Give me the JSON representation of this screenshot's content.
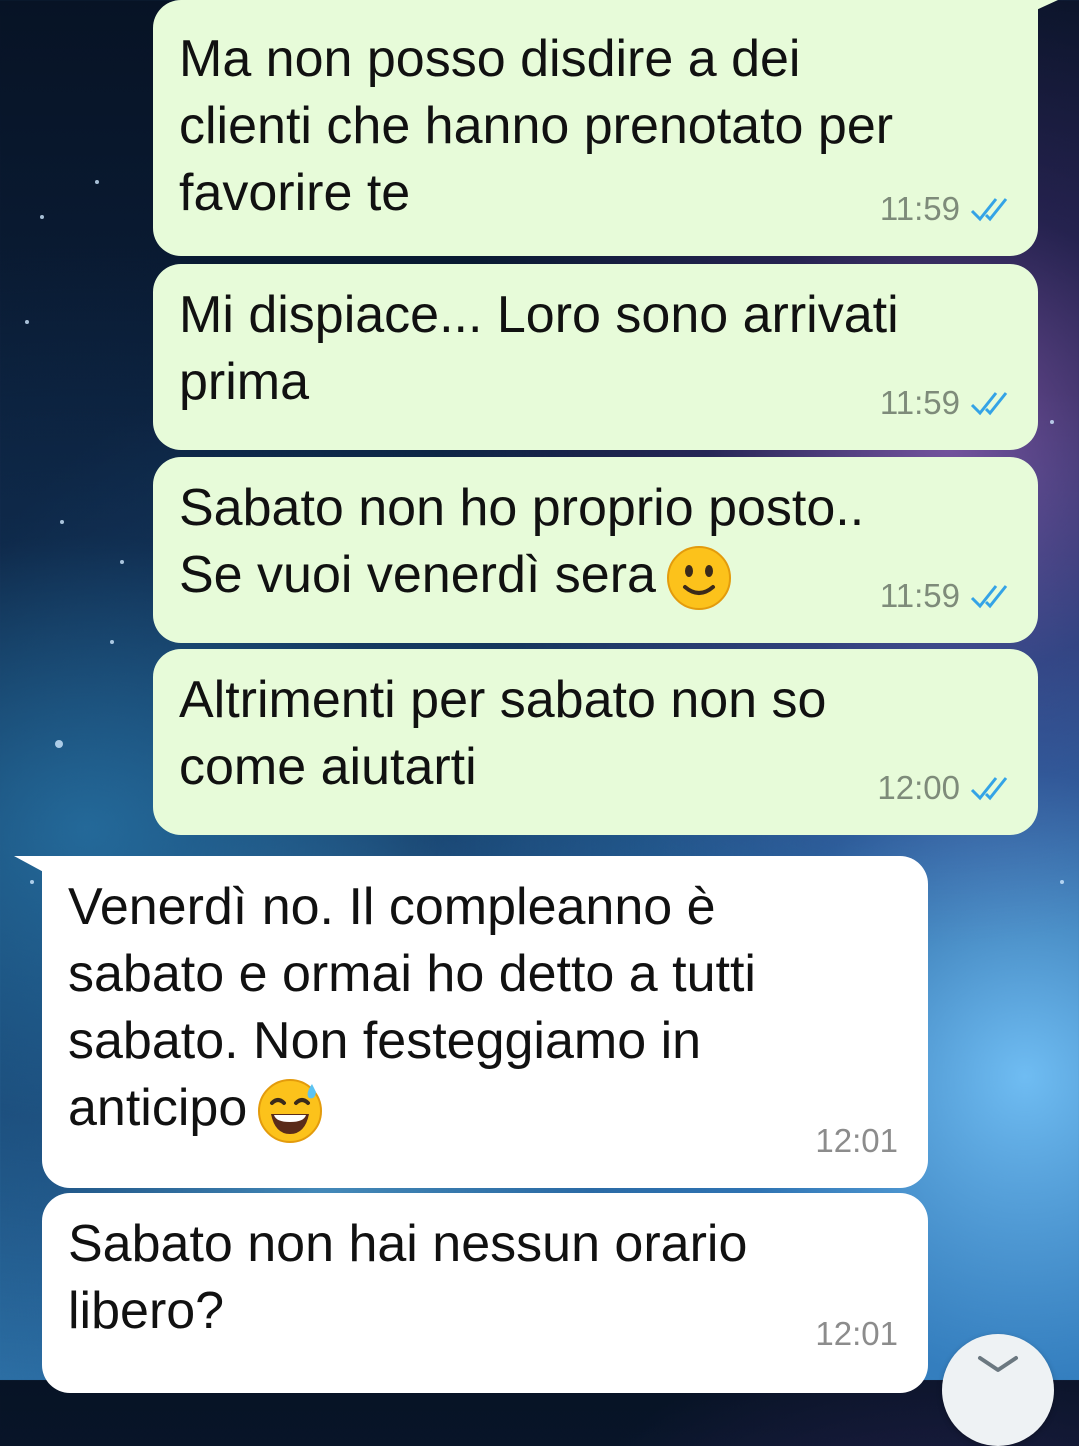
{
  "messages": [
    {
      "dir": "out",
      "text": "Ma non posso disdire a dei\nclienti che hanno prenotato per\nfavorire te",
      "time": "11:59",
      "status": "read"
    },
    {
      "dir": "out",
      "text": "Mi dispiace... Loro sono arrivati\nprima",
      "time": "11:59",
      "status": "read"
    },
    {
      "dir": "out",
      "text": "Sabato non ho proprio posto..\nSe vuoi venerdì sera",
      "emoji": "slightly-smiling-face",
      "time": "11:59",
      "status": "read"
    },
    {
      "dir": "out",
      "text": "Altrimenti per sabato non so\ncome aiutarti",
      "time": "12:00",
      "status": "read"
    },
    {
      "dir": "in",
      "text": "Venerdì no. Il compleanno è\nsabato e ormai ho detto a tutti\nsabato. Non festeggiamo in\nanticipo",
      "emoji": "grinning-face-with-sweat",
      "time": "12:01"
    },
    {
      "dir": "in",
      "text": "Sabato non hai nessun orario\nlibero?",
      "time": "12:01"
    }
  ],
  "colors": {
    "outgoing_bubble": "#e7fbd9",
    "incoming_bubble": "#ffffff",
    "read_ticks": "#34a3e6"
  },
  "scroll_button_icon": "chevron-down-icon"
}
